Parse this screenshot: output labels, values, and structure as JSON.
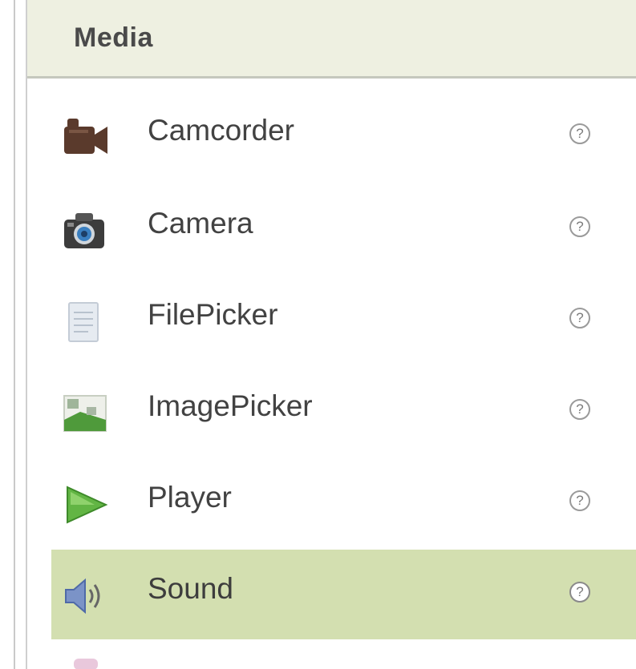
{
  "panel": {
    "title": "Media",
    "items": [
      {
        "label": "Camcorder",
        "icon": "camcorder-icon",
        "help": "?"
      },
      {
        "label": "Camera",
        "icon": "camera-icon",
        "help": "?"
      },
      {
        "label": "FilePicker",
        "icon": "file-icon",
        "help": "?"
      },
      {
        "label": "ImagePicker",
        "icon": "image-picker-icon",
        "help": "?"
      },
      {
        "label": "Player",
        "icon": "play-icon",
        "help": "?"
      },
      {
        "label": "Sound",
        "icon": "speaker-icon",
        "help": "?",
        "selected": true
      }
    ]
  },
  "colors": {
    "header_bg": "#eef0e1",
    "selected_bg": "#d3dfb0",
    "text": "#424242"
  }
}
